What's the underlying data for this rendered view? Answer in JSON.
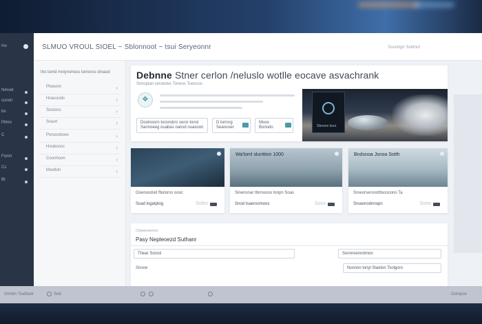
{
  "app": {
    "title": "SLMUO VROUL SIOEL ~ Sblonnoot ~ tsui Seryeonnr",
    "header_right": "Soundgrt Sobtnnt"
  },
  "rail": {
    "top_label": "Inv",
    "items": [
      "Nmoet",
      "cunon",
      "bn",
      "Pllmn",
      "C",
      "Fonm",
      "Cs",
      "Bt"
    ]
  },
  "subnav": {
    "heading": "tho tomd mniynohoos tomoros droasd",
    "items": [
      "Ploeonn",
      "Hoacoods",
      "Sostons",
      "Sraurt",
      "Ponosvboes",
      "Houbonsc",
      "Coonhoon",
      "Moelton"
    ]
  },
  "hero": {
    "headline_bold": "Debnne",
    "headline_rest": "Stner cerlon  /neluslo wotlle eocave asvachrank",
    "subtitle": "Simoplan seratoles Toneos Toonsos",
    "bubble": "✥",
    "field1_line1": "Doolnoorn toronsbrs seror tonst",
    "field1_line2": "Sannoeeg ouabas oansd ouasoon",
    "field2_line1": "D torrorg",
    "field2_line2": "Seancoer",
    "field3_line1": "Mooo",
    "field3_line2": "Bonodo",
    "device_caption": "Sbnnoe teoo"
  },
  "cards": [
    {
      "title": "",
      "desc": "Ooenoodod fboloros oooc",
      "meta": "Soad logatplog",
      "price": "Soleo",
      "img": [
        "#2b4358",
        "#3e5d75",
        "#1c2c3b"
      ]
    },
    {
      "title": "Wa'loml slunttion 1000",
      "desc": "Sinenonar tbnnoooo tonpn Soas",
      "meta": "Snod tsaeroomoos",
      "price": "Soco",
      "img": [
        "#b8c6cf",
        "#8fa3ae",
        "#58707d"
      ]
    },
    {
      "title": "Bndsnoa Jsnoa Sotth",
      "desc": "Sroeorsersoottlooocono Ta",
      "meta": "Sroaonodnnopn",
      "price": "Sooo",
      "img": [
        "#cfdbe1",
        "#a6b9c3",
        "#6f8591"
      ]
    }
  ],
  "form": {
    "small_label": "Cnteanosonon",
    "title": "Pasy Nepleoezd Suthanr",
    "field1": "Thear Sorosl",
    "field2": "Sonnroenrotmon",
    "label": "Snooe",
    "field3": "Nosnon lonyl Slaoton Tsolgoro"
  },
  "bottombar": {
    "left": "Omrlm 'Sudlook",
    "mid": "Sod",
    "right": "Oompoo"
  },
  "colors": {
    "rail": "#2a3447",
    "accent": "#4d9aa7",
    "window": "#eef1f5"
  }
}
